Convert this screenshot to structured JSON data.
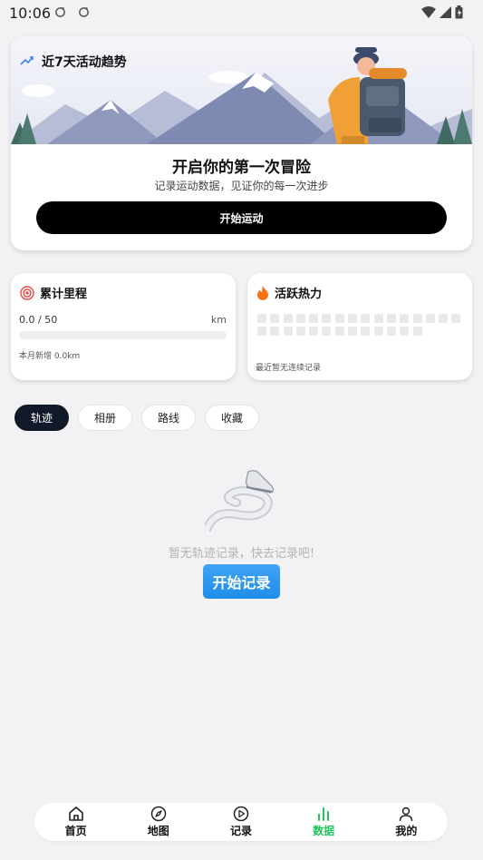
{
  "status_bar": {
    "time": "10:06"
  },
  "hero": {
    "trend_title": "近7天活动趋势",
    "headline": "开启你的第一次冒险",
    "subtitle": "记录运动数据，见证你的每一次进步",
    "start_button": "开始运动"
  },
  "mileage_card": {
    "title": "累计里程",
    "value": "0.0 / 50",
    "unit": "km",
    "progress_fraction": 0.0,
    "month_note": "本月新增 0.0km"
  },
  "heat_card": {
    "title": "活跃热力",
    "note": "最近暂无连续记录"
  },
  "tabs": [
    {
      "label": "轨迹",
      "active": true
    },
    {
      "label": "相册",
      "active": false
    },
    {
      "label": "路线",
      "active": false
    },
    {
      "label": "收藏",
      "active": false
    }
  ],
  "empty_state": {
    "text": "暂无轨迹记录，快去记录吧!",
    "button": "开始记录"
  },
  "bottom_nav": [
    {
      "label": "首页",
      "icon": "home-icon"
    },
    {
      "label": "地图",
      "icon": "compass-icon"
    },
    {
      "label": "记录",
      "icon": "play-circle-icon"
    },
    {
      "label": "数据",
      "icon": "bar-chart-icon",
      "active": true
    },
    {
      "label": "我的",
      "icon": "user-icon"
    }
  ],
  "colors": {
    "accent_green": "#22c55e",
    "button_blue": "#1f8ee8",
    "tab_active": "#111827"
  }
}
